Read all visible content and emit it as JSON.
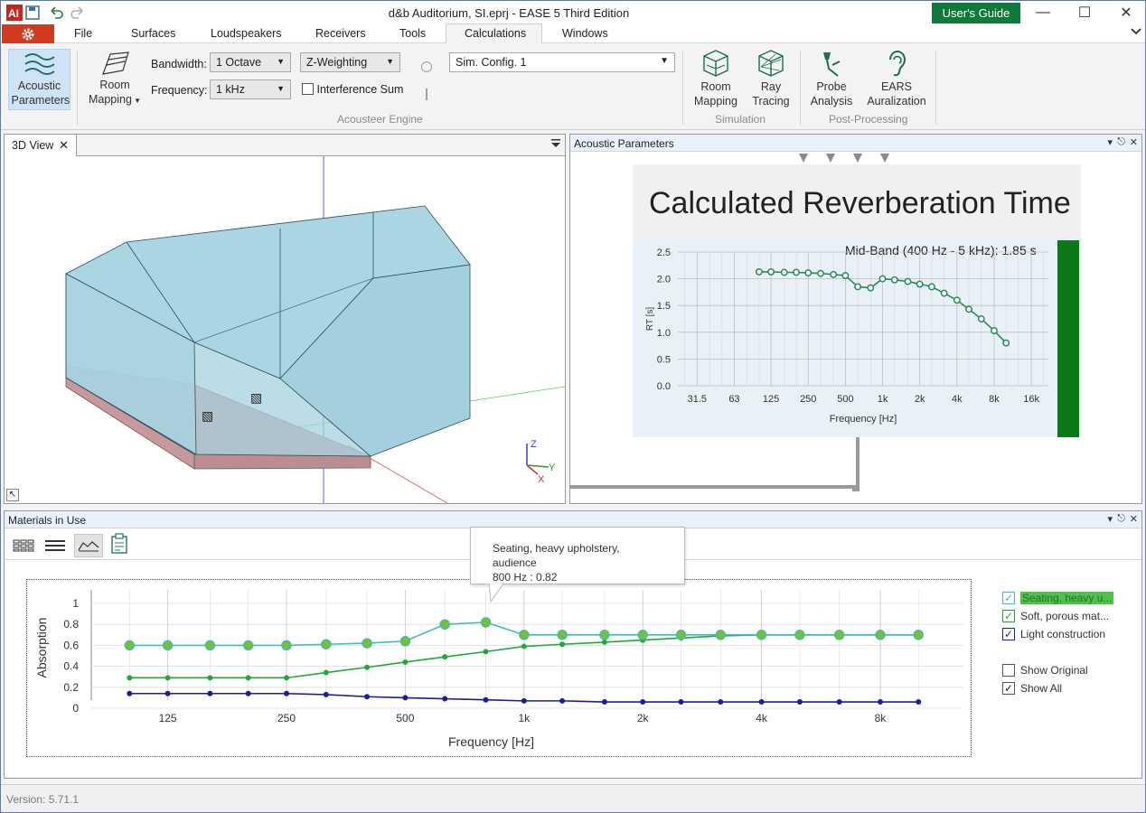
{
  "window": {
    "title": "d&b Auditorium, SI.eprj - EASE 5 Third Edition",
    "guide_button": "User's Guide"
  },
  "menu": {
    "items": [
      "File",
      "Surfaces",
      "Loudspeakers",
      "Receivers",
      "Tools",
      "Calculations",
      "Windows"
    ],
    "active": "Calculations"
  },
  "ribbon": {
    "acoustic_params": "Acoustic Parameters",
    "room_mapping_l1": "Room",
    "room_mapping_l2": "Mapping",
    "bandwidth_label": "Bandwidth:",
    "bandwidth_value": "1 Octave",
    "weighting_value": "Z-Weighting",
    "frequency_label": "Frequency:",
    "frequency_value": "1 kHz",
    "interference_sum": "Interference Sum",
    "sim_config": "Sim. Config. 1",
    "engine_group": "Acousteer Engine",
    "sim_room_l1": "Room",
    "sim_room_l2": "Mapping",
    "ray_l1": "Ray",
    "ray_l2": "Tracing",
    "sim_group": "Simulation",
    "probe_l1": "Probe",
    "probe_l2": "Analysis",
    "ears_l1": "EARS",
    "ears_l2": "Auralization",
    "post_group": "Post-Processing"
  },
  "view3d": {
    "tab": "3D View",
    "axis_x": "X",
    "axis_y": "Y",
    "axis_z": "Z"
  },
  "acoustic_panel": {
    "title": "Acoustic Parameters",
    "heading": "Calculated Reverberation Time",
    "midband": "Mid-Band (400 Hz - 5 kHz):  1.85  s",
    "accent_color": "#0a7a16"
  },
  "materials": {
    "title": "Materials in Use",
    "tooltip_line1": "Seating, heavy upholstery, audience",
    "tooltip_line2": "800 Hz : 0.82",
    "legend": [
      {
        "label": "Seating, heavy u...",
        "checked": true,
        "color": "#3fbdbd",
        "highlight": "#4cc24a"
      },
      {
        "label": "Soft, porous mat...",
        "checked": true,
        "color": "#22a83a"
      },
      {
        "label": "Light construction",
        "checked": true,
        "color": "#1c1c9c"
      }
    ],
    "show_original": "Show Original",
    "show_all": "Show All"
  },
  "status": {
    "version": "Version: 5.71.1"
  },
  "chart_data": [
    {
      "type": "line",
      "title": "",
      "xlabel": "Frequency [Hz]",
      "ylabel": "RT [s]",
      "x_scale": "log",
      "xticks": [
        "31.5",
        "63",
        "125",
        "250",
        "500",
        "1k",
        "2k",
        "4k",
        "8k",
        "16k"
      ],
      "yticks": [
        "0.0",
        "0.5",
        "1.0",
        "1.5",
        "2.0",
        "2.5"
      ],
      "ylim": [
        0,
        2.5
      ],
      "grid": true,
      "series": [
        {
          "x": [
            100,
            125,
            160,
            200,
            250,
            315,
            400,
            500,
            630,
            800,
            1000,
            1250,
            1600,
            2000,
            2500,
            3150,
            4000,
            5000,
            6300,
            8000,
            10000
          ],
          "values": [
            2.13,
            2.13,
            2.12,
            2.12,
            2.11,
            2.1,
            2.08,
            2.06,
            1.85,
            1.83,
            2.0,
            1.98,
            1.95,
            1.9,
            1.85,
            1.73,
            1.6,
            1.43,
            1.25,
            1.03,
            0.8
          ],
          "color": "#2a8a5a"
        }
      ]
    },
    {
      "type": "line",
      "title": "",
      "xlabel": "Frequency [Hz]",
      "ylabel": "Absorption",
      "x_scale": "log",
      "xticks": [
        "125",
        "250",
        "500",
        "1k",
        "2k",
        "4k",
        "8k"
      ],
      "yticks": [
        "0",
        "0.2",
        "0.4",
        "0.6",
        "0.8",
        "1"
      ],
      "ylim": [
        0,
        1
      ],
      "grid": true,
      "x": [
        100,
        125,
        160,
        200,
        250,
        315,
        400,
        500,
        630,
        800,
        1000,
        1250,
        1600,
        2000,
        2500,
        3150,
        4000,
        5000,
        6300,
        8000,
        10000
      ],
      "series": [
        {
          "name": "Seating, heavy u...",
          "color": "#3fbdbd",
          "values": [
            0.6,
            0.6,
            0.6,
            0.6,
            0.6,
            0.61,
            0.62,
            0.64,
            0.8,
            0.82,
            0.7,
            0.7,
            0.7,
            0.7,
            0.7,
            0.7,
            0.7,
            0.7,
            0.7,
            0.7,
            0.7
          ]
        },
        {
          "name": "Soft, porous mat...",
          "color": "#22a83a",
          "values": [
            0.29,
            0.29,
            0.29,
            0.29,
            0.29,
            0.34,
            0.39,
            0.44,
            0.49,
            0.54,
            0.59,
            0.61,
            0.63,
            0.65,
            0.67,
            0.69,
            0.7,
            0.7,
            0.7,
            0.7,
            0.7
          ]
        },
        {
          "name": "Light construction",
          "color": "#1c1c9c",
          "values": [
            0.14,
            0.14,
            0.14,
            0.14,
            0.14,
            0.13,
            0.11,
            0.1,
            0.09,
            0.08,
            0.07,
            0.07,
            0.06,
            0.06,
            0.06,
            0.06,
            0.06,
            0.06,
            0.06,
            0.06,
            0.06
          ]
        }
      ]
    }
  ]
}
